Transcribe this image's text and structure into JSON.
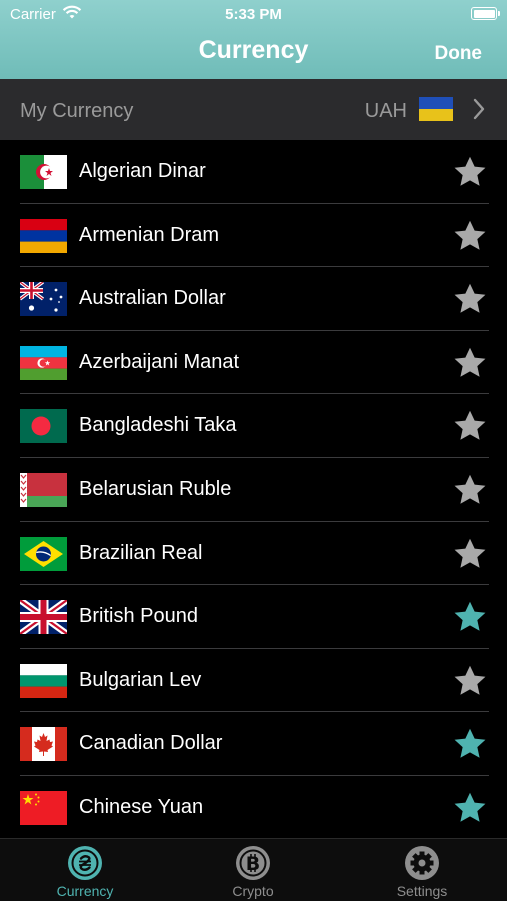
{
  "status": {
    "carrier": "Carrier",
    "time": "5:33 PM"
  },
  "nav": {
    "title": "Currency",
    "done_label": "Done"
  },
  "my_currency": {
    "label": "My Currency",
    "code": "UAH"
  },
  "colors": {
    "accent": "#4fb3b0",
    "star_inactive": "#a9a9a9"
  },
  "currencies": [
    {
      "name": "Algerian Dinar",
      "favorite": false
    },
    {
      "name": "Armenian Dram",
      "favorite": false
    },
    {
      "name": "Australian Dollar",
      "favorite": false
    },
    {
      "name": "Azerbaijani Manat",
      "favorite": false
    },
    {
      "name": "Bangladeshi Taka",
      "favorite": false
    },
    {
      "name": "Belarusian Ruble",
      "favorite": false
    },
    {
      "name": "Brazilian Real",
      "favorite": false
    },
    {
      "name": "British Pound",
      "favorite": true
    },
    {
      "name": "Bulgarian Lev",
      "favorite": false
    },
    {
      "name": "Canadian Dollar",
      "favorite": true
    },
    {
      "name": "Chinese Yuan",
      "favorite": true
    }
  ],
  "tabs": [
    {
      "label": "Currency",
      "icon": "hryvnia-icon",
      "active": true
    },
    {
      "label": "Crypto",
      "icon": "bitcoin-icon",
      "active": false
    },
    {
      "label": "Settings",
      "icon": "gear-icon",
      "active": false
    }
  ]
}
